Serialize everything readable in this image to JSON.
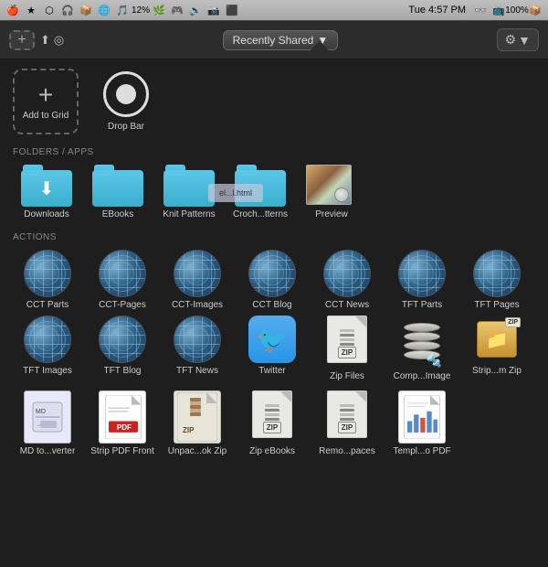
{
  "menubar": {
    "time": "Tue 4:57 PM",
    "battery": "100%",
    "wifi": "12%"
  },
  "toolbar": {
    "add_label": "+",
    "recently_shared": "Recently Shared",
    "recently_shared_arrow": "▼",
    "gear": "⚙",
    "gear_arrow": "▼"
  },
  "add_drop": {
    "add_grid_label": "Add to Grid",
    "drop_bar_label": "Drop Bar"
  },
  "sections": {
    "folders_header": "FOLDERS / APPS",
    "actions_header": "ACTIONS"
  },
  "folders": [
    {
      "label": "Downloads"
    },
    {
      "label": "EBooks"
    },
    {
      "label": "Knit Patterns"
    },
    {
      "label": "Croch...tterns"
    },
    {
      "label": "Preview",
      "type": "preview"
    }
  ],
  "actions": [
    {
      "label": "CCT Parts",
      "type": "globe"
    },
    {
      "label": "CCT-Pages",
      "type": "globe"
    },
    {
      "label": "CCT-Images",
      "type": "globe"
    },
    {
      "label": "CCT Blog",
      "type": "globe"
    },
    {
      "label": "CCT News",
      "type": "globe"
    },
    {
      "label": "TFT Parts",
      "type": "globe"
    },
    {
      "label": "TFT Pages",
      "type": "globe"
    },
    {
      "label": "TFT Images",
      "type": "globe"
    },
    {
      "label": "TFT Blog",
      "type": "globe"
    },
    {
      "label": "TFT News",
      "type": "globe"
    },
    {
      "label": "Twitter",
      "type": "twitter"
    },
    {
      "label": "Zip Files",
      "type": "zip"
    },
    {
      "label": "Comp...Image",
      "type": "comp"
    },
    {
      "label": "Strip...m Zip",
      "type": "strip"
    }
  ],
  "bottom_actions": [
    {
      "label": "MD to...verter",
      "type": "md"
    },
    {
      "label": "Strip PDF Front",
      "type": "pdf"
    },
    {
      "label": "Unpac...ok Zip",
      "type": "unpack"
    },
    {
      "label": "Zip eBooks",
      "type": "zip"
    },
    {
      "label": "Remo...paces",
      "type": "zip"
    },
    {
      "label": "Templ...o PDF",
      "type": "templ"
    }
  ],
  "drag_ghost": {
    "text": "el...l.html"
  }
}
